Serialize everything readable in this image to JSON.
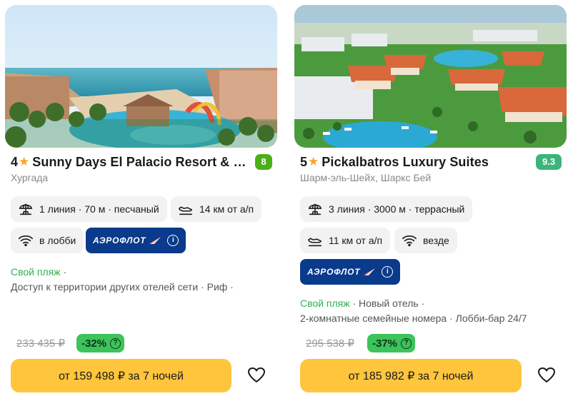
{
  "cards": [
    {
      "stars": "4",
      "name": "Sunny Days El Palacio Resort & Spa",
      "rating": "8",
      "location": "Хургада",
      "chips": {
        "beach": "1 линия · 70 м · песчаный",
        "airport": "14 км от а/п",
        "wifi": "в лобби"
      },
      "airline": "АЭРОФЛОТ",
      "features_green": "Свой пляж",
      "features_line1_rest": " ·",
      "features_line2": "Доступ к территории других отелей сети · Риф ·",
      "old_price": "233 435 ₽",
      "discount": "-32%",
      "button": "от 159 498 ₽ за 7 ночей"
    },
    {
      "stars": "5",
      "name": "Pickalbatros Luxury Suites",
      "rating": "9.3",
      "location": "Шарм-эль-Шейх, Шаркс Бей",
      "chips": {
        "beach": "3 линия · 3000 м · террасный",
        "airport": "11 км от а/п",
        "wifi": "везде"
      },
      "airline": "АЭРОФЛОТ",
      "features_green": "Свой пляж",
      "features_line1_rest": " · Новый отель ·",
      "features_line2": "2-комнатные семейные номера · Лобби-бар 24/7",
      "old_price": "295 538 ₽",
      "discount": "-37%",
      "button": "от 185 982 ₽ за 7 ночей"
    }
  ],
  "icons": {
    "star": "star-icon",
    "beach": "beach-umbrella-icon",
    "airport": "plane-landing-icon",
    "wifi": "wifi-icon",
    "info": "info-icon",
    "question": "question-icon",
    "favorite": "heart-icon"
  },
  "colors": {
    "accent_button": "#ffc53d",
    "rating_green_1": "#4caf1a",
    "rating_green_2": "#3cb57a",
    "discount_green": "#3cc35a",
    "aeroflot_blue": "#0a3a8c",
    "feature_green": "#2fb24c"
  }
}
